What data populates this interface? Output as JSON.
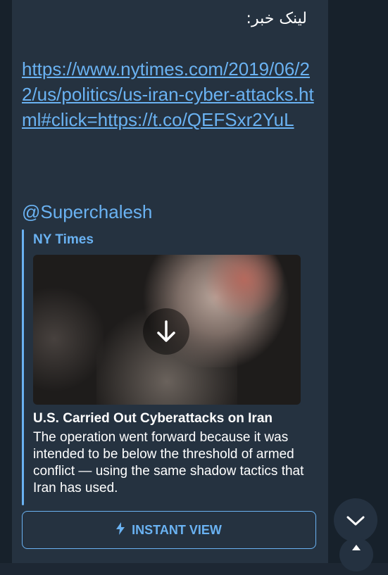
{
  "message": {
    "link_label": "لینک خبر:",
    "article_url": "https://www.nytimes.com/2019/06/22/us/politics/us-iran-cyber-attacks.html#click=https://t.co/QEFSxr2YuL",
    "mention": "@Superchalesh"
  },
  "link_preview": {
    "site_name": "NY Times",
    "title": "U.S. Carried Out Cyberattacks on Iran",
    "description": "The operation went forward because it was intended to be below the threshold of armed conflict — using the same shadow tactics that Iran has used.",
    "image_action_icon": "download-arrow-icon"
  },
  "instant_view": {
    "label": "INSTANT VIEW",
    "icon": "lightning-bolt-icon"
  },
  "fab": {
    "scroll_down_icon": "chevron-down-icon"
  },
  "colors": {
    "link": "#6ab2f2",
    "bubble": "#253240",
    "background": "#17212b",
    "text": "#ffffff"
  }
}
